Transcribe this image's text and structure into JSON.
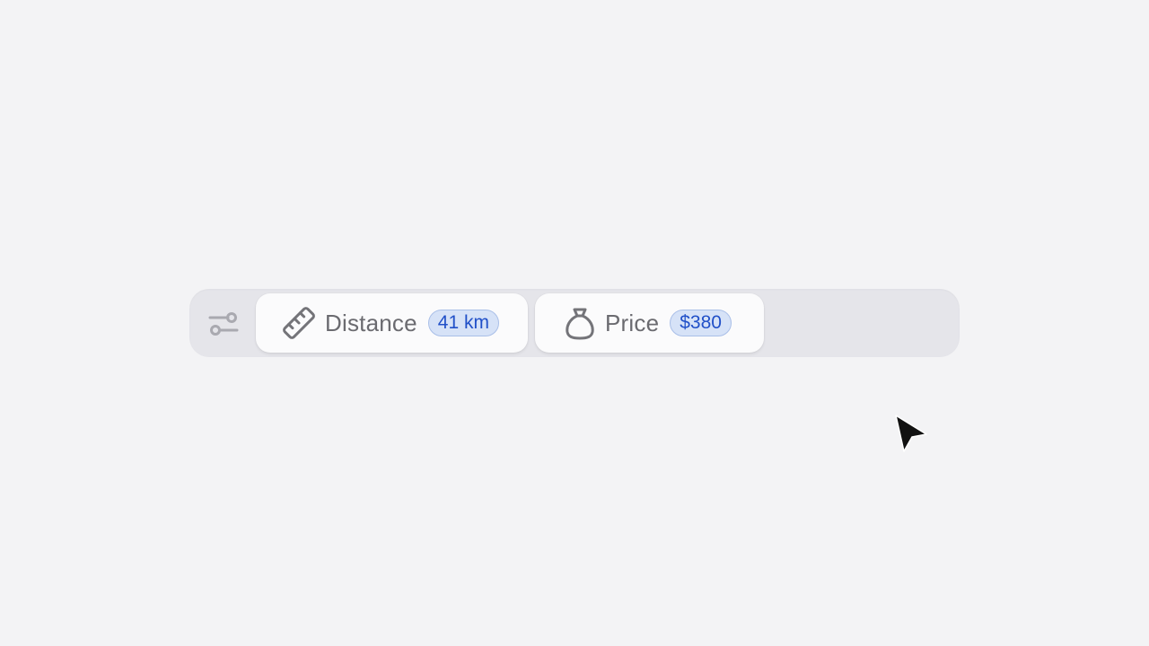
{
  "filter_bar": {
    "toggle_icon": "sliders-icon",
    "chips": [
      {
        "label": "Distance",
        "value": "41 km",
        "icon": "ruler-icon"
      },
      {
        "label": "Price",
        "value": "$380",
        "icon": "money-bag-icon"
      }
    ]
  },
  "colors": {
    "background": "#f3f3f5",
    "bar_background": "#e5e5ea",
    "chip_background": "#fbfbfc",
    "label_text": "#6b6b70",
    "badge_background": "#d6e2f7",
    "badge_border": "#a9bfe8",
    "badge_text": "#2150c8"
  },
  "cursor": {
    "icon": "mouse-pointer-icon"
  }
}
